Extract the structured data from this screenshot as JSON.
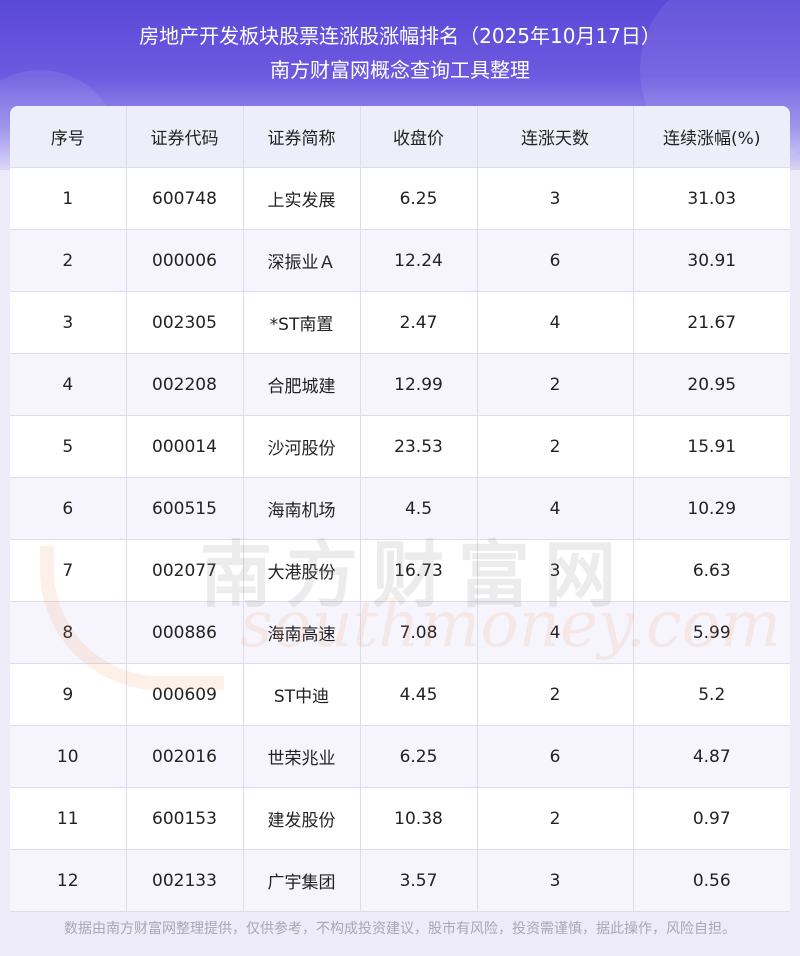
{
  "header": {
    "title": "房地产开发板块股票连涨股涨幅排名（2025年10月17日）",
    "subtitle": "南方财富网概念查询工具整理"
  },
  "table": {
    "columns": [
      "序号",
      "证券代码",
      "证券简称",
      "收盘价",
      "连涨天数",
      "连续涨幅(%)"
    ],
    "rows": [
      [
        "1",
        "600748",
        "上实发展",
        "6.25",
        "3",
        "31.03"
      ],
      [
        "2",
        "000006",
        "深振业Ａ",
        "12.24",
        "6",
        "30.91"
      ],
      [
        "3",
        "002305",
        "*ST南置",
        "2.47",
        "4",
        "21.67"
      ],
      [
        "4",
        "002208",
        "合肥城建",
        "12.99",
        "2",
        "20.95"
      ],
      [
        "5",
        "000014",
        "沙河股份",
        "23.53",
        "2",
        "15.91"
      ],
      [
        "6",
        "600515",
        "海南机场",
        "4.5",
        "4",
        "10.29"
      ],
      [
        "7",
        "002077",
        "大港股份",
        "16.73",
        "3",
        "6.63"
      ],
      [
        "8",
        "000886",
        "海南高速",
        "7.08",
        "4",
        "5.99"
      ],
      [
        "9",
        "000609",
        "ST中迪",
        "4.45",
        "2",
        "5.2"
      ],
      [
        "10",
        "002016",
        "世荣兆业",
        "6.25",
        "6",
        "4.87"
      ],
      [
        "11",
        "600153",
        "建发股份",
        "10.38",
        "2",
        "0.97"
      ],
      [
        "12",
        "002133",
        "广宇集团",
        "3.57",
        "3",
        "0.56"
      ]
    ]
  },
  "watermark": {
    "cn": "南方财富网",
    "en": "southmoney.com"
  },
  "footer": {
    "disclaimer": "数据由南方财富网整理提供，仅供参考，不构成投资建议，股市有风险，投资需谨慎，据此操作，风险自担。"
  },
  "colors": {
    "header_top": "#5a48d8",
    "header_bottom": "#d9d4f6",
    "table_header_bg": "#eeeefb",
    "row_alt_bg": "#f6f5fd"
  }
}
